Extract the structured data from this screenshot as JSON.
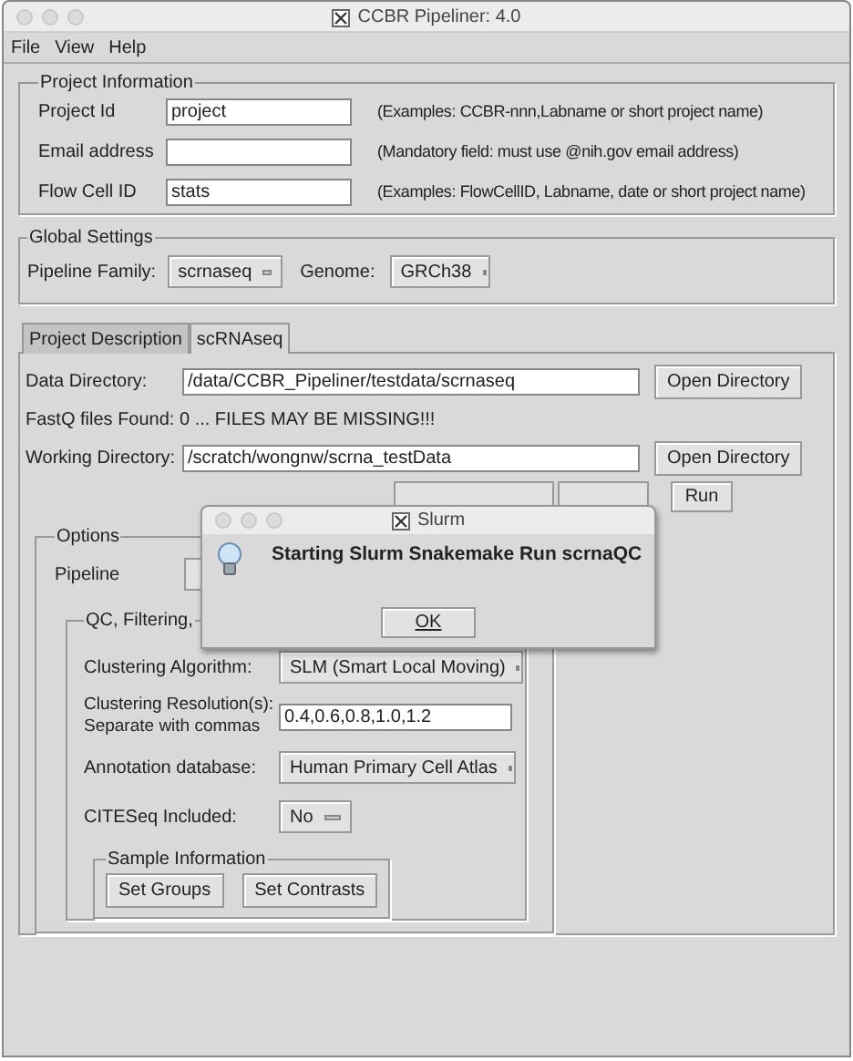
{
  "window": {
    "title": "CCBR Pipeliner: 4.0"
  },
  "menu": [
    "File",
    "View",
    "Help"
  ],
  "project_information": {
    "title": "Project Information",
    "fields": [
      {
        "label": "Project Id",
        "value": "project",
        "hint": "(Examples: CCBR-nnn,Labname or short project name)"
      },
      {
        "label": "Email address",
        "hint": "(Mandatory field: must use @nih.gov email address)"
      },
      {
        "label": "Flow Cell ID",
        "value": "stats",
        "hint": "(Examples: FlowCellID, Labname, date or short project name)"
      }
    ]
  },
  "global_settings": {
    "title": "Global Settings",
    "pipeline_family": {
      "label": "Pipeline Family:",
      "value": "scrnaseq"
    },
    "genome": {
      "label": "Genome:",
      "value": "GRCh38"
    }
  },
  "tabs": [
    {
      "label": "Project Description",
      "selected": false
    },
    {
      "label": "scRNAseq",
      "selected": true
    }
  ],
  "data_directory": {
    "label": "Data Directory:",
    "value": "/data/CCBR_Pipeliner/testdata/scrnaseq",
    "button": "Open Directory"
  },
  "fastq_status": "FastQ files Found: 0 ... FILES MAY BE MISSING!!!",
  "working_directory": {
    "label": "Working Directory:",
    "value": "/scratch/wongnw/scrna_testData",
    "button": "Open Directory"
  },
  "run_button": "Run",
  "options": {
    "title": "Options",
    "pipeline_label": "Pipeline",
    "qc_title": "QC, Filtering,",
    "clustering_algorithm": {
      "label": "Clustering Algorithm:",
      "value": "SLM (Smart Local Moving)"
    },
    "clustering_resolution": {
      "label": "Clustering Resolution(s):",
      "sublabel": "Separate with commas",
      "value": "0.4,0.6,0.8,1.0,1.2"
    },
    "annotation_database": {
      "label": "Annotation database:",
      "value": "Human Primary Cell Atlas"
    },
    "citeseq": {
      "label": "CITESeq Included:",
      "value": "No"
    },
    "sample_information": {
      "title": "Sample Information",
      "buttons": [
        "Set Groups",
        "Set Contrasts"
      ]
    }
  },
  "dialog": {
    "title": "Slurm",
    "message": "Starting Slurm Snakemake Run scrnaQC",
    "button": "OK"
  }
}
